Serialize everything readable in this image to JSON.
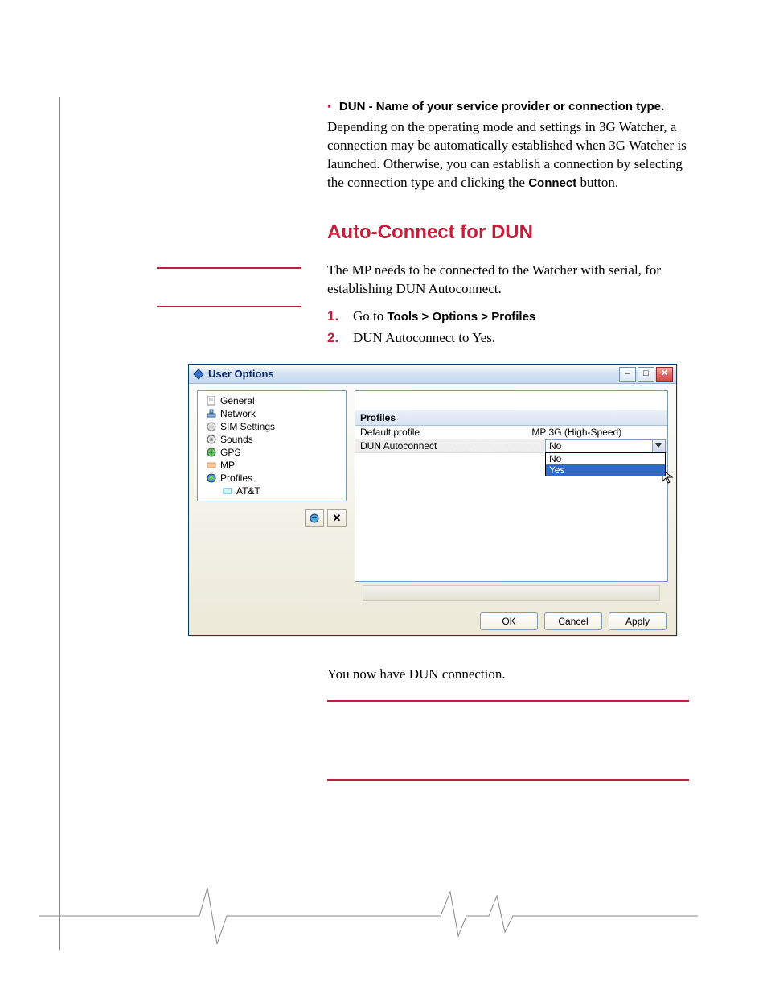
{
  "bullet": {
    "text": "DUN - Name of your service provider or connection type."
  },
  "para1_a": "Depending on the operating mode and settings in 3G Watcher, a connection may be automatically established when 3G Watcher is launched. Otherwise, you can establish a connection by selecting the connection type and clicking the ",
  "para1_bold": "Connect",
  "para1_b": " button.",
  "h2": "Auto-Connect for DUN",
  "para2": "The MP needs to be connected to the Watcher with serial, for establishing DUN Autoconnect.",
  "steps": [
    {
      "num": "1.",
      "pre": "Go to ",
      "bold": "Tools > Options > Profiles",
      "post": ""
    },
    {
      "num": "2.",
      "pre": "",
      "bold": "",
      "post": "DUN Autoconnect to Yes."
    }
  ],
  "dialog": {
    "title": "User Options",
    "tree": [
      {
        "label": "General",
        "icon": "page"
      },
      {
        "label": "Network",
        "icon": "net"
      },
      {
        "label": "SIM Settings",
        "icon": "sim"
      },
      {
        "label": "Sounds",
        "icon": "snd"
      },
      {
        "label": "GPS",
        "icon": "gps"
      },
      {
        "label": "MP",
        "icon": "mp"
      },
      {
        "label": "Profiles",
        "icon": "prof"
      },
      {
        "label": "AT&T",
        "icon": "att",
        "indent": true
      }
    ],
    "panel_header": "Profiles",
    "rows": [
      {
        "l": "Default profile",
        "r": "MP 3G (High-Speed)"
      },
      {
        "l": "DUN Autoconnect",
        "r": "No",
        "sel": true
      }
    ],
    "combo_value": "No",
    "options": [
      "No",
      "Yes"
    ],
    "buttons": {
      "ok": "OK",
      "cancel": "Cancel",
      "apply": "Apply"
    }
  },
  "post": "You now have DUN connection."
}
